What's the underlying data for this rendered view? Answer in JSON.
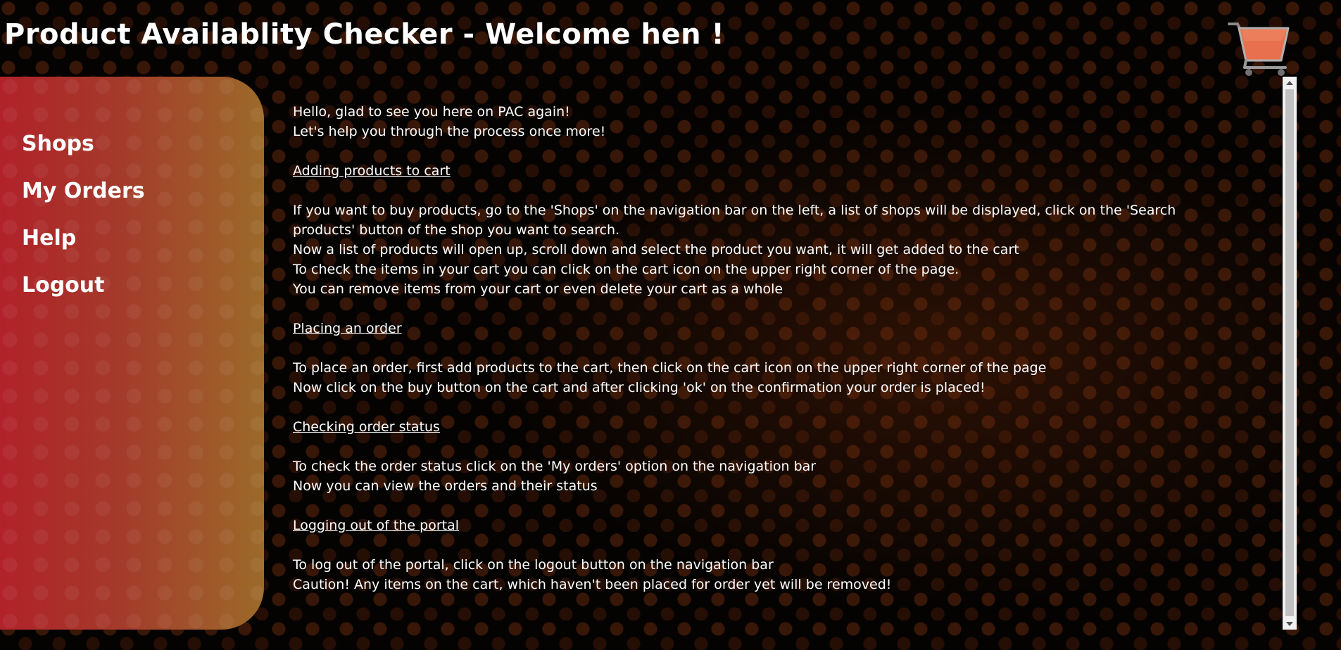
{
  "header": {
    "title": "Product Availablity Checker - Welcome hen !",
    "cart_icon": "shopping-cart-icon"
  },
  "sidebar": {
    "items": [
      {
        "label": "Shops"
      },
      {
        "label": "My Orders"
      },
      {
        "label": "Help"
      },
      {
        "label": "Logout"
      }
    ]
  },
  "help": {
    "intro": [
      "Hello, glad to see you here on PAC again!",
      "Let's help you through the process once more!"
    ],
    "sections": [
      {
        "heading": "Adding products to cart",
        "lines": [
          "If you want to buy products, go to the 'Shops' on the navigation bar on the left, a list of shops will be displayed, click on the 'Search products' button of the shop you want to search.",
          "Now a list of products will open up, scroll down and select the product you want, it will get added to the cart",
          "To check the items in your cart you can click on the cart icon on the upper right corner of the page.",
          "You can remove items from your cart or even delete your cart as a whole"
        ]
      },
      {
        "heading": "Placing an order",
        "lines": [
          "To place an order, first add products to the cart, then click on the cart icon on the upper right corner of the page",
          "Now click on the buy button on the cart and after clicking 'ok' on the confirmation your order is placed!"
        ]
      },
      {
        "heading": "Checking order status",
        "lines": [
          "To check the order status click on the 'My orders' option on the navigation bar",
          "Now you can view the orders and their status"
        ]
      },
      {
        "heading": "Logging out of the portal",
        "lines": [
          "To log out of the portal, click on the logout button on the navigation bar",
          "Caution! Any items on the cart, which haven't been placed for order yet will be removed!"
        ]
      }
    ]
  },
  "colors": {
    "sidebar_start": "#b1222a",
    "sidebar_end": "#9c6a2a",
    "cart": "#e8704f",
    "text": "#ffffff",
    "background": "#050302"
  }
}
